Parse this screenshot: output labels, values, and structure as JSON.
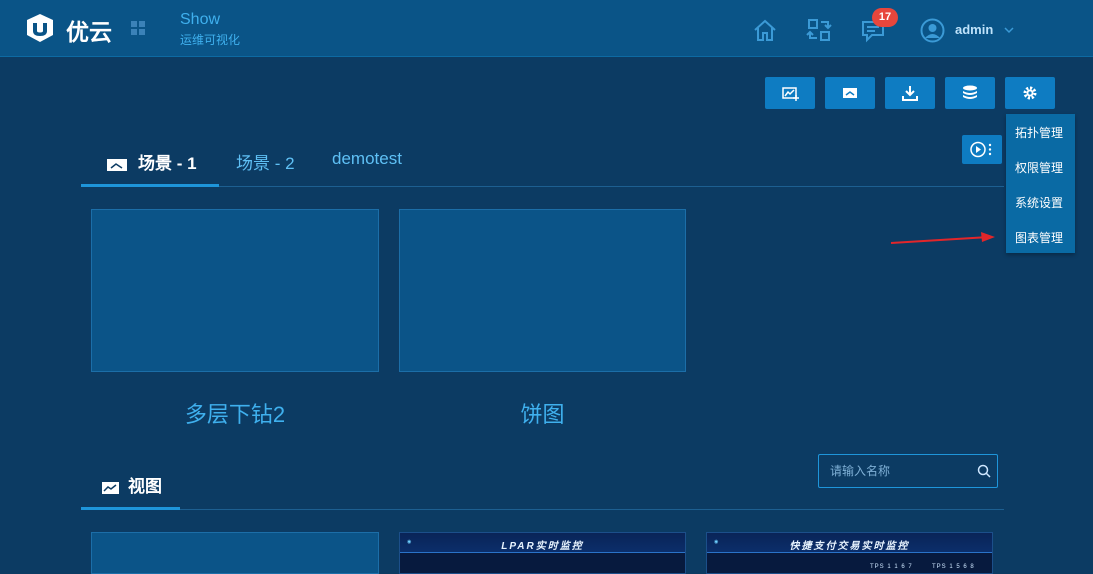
{
  "brand": {
    "name": "优云",
    "app": "Show",
    "subtitle": "运维可视化"
  },
  "header": {
    "notification_count": "17",
    "username": "admin"
  },
  "toolbar": {
    "buttons": [
      "add-chart-icon",
      "add-scene-icon",
      "download-icon",
      "database-icon",
      "gear-icon"
    ]
  },
  "settings_menu": {
    "items": [
      "拓扑管理",
      "权限管理",
      "系统设置",
      "图表管理"
    ]
  },
  "scene_tabs": {
    "tabs": [
      "场景 - 1",
      "场景 - 2",
      "demotest"
    ],
    "active": 0
  },
  "scenes": [
    {
      "title": "多层下钻2"
    },
    {
      "title": "饼图"
    }
  ],
  "views_section": {
    "title": "视图",
    "search_placeholder": "请输入名称"
  },
  "view_thumbs": [
    {
      "title": ""
    },
    {
      "title": "LPAR实时监控"
    },
    {
      "title": "快捷支付交易实时监控",
      "stat1": "TPS 1 1 6 7",
      "stat2": "TPS 1 5 6 8"
    }
  ],
  "colors": {
    "background": "#0c3b63",
    "header": "#0a5487",
    "accent": "#1e95da",
    "link": "#3fb0ee",
    "badge": "#e8463c",
    "annotation_arrow": "#e2262a"
  }
}
